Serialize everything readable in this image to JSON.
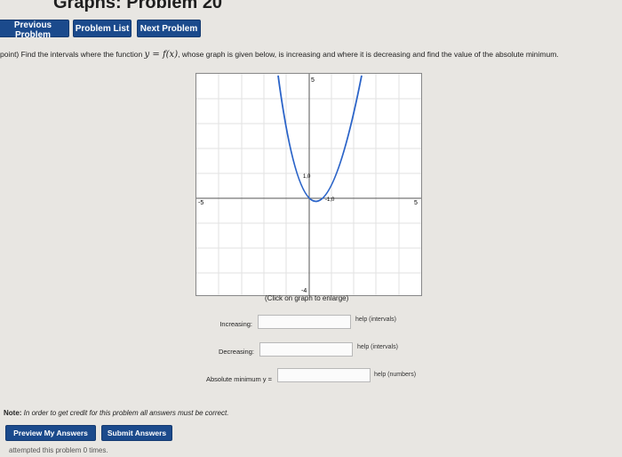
{
  "header": {
    "title": "Graphs: Problem 20"
  },
  "nav": {
    "previous_label": "Previous Problem",
    "list_label": "Problem List",
    "next_label": "Next Problem"
  },
  "problem": {
    "prefix": "point) Find the intervals where the function",
    "func_y": "y",
    "func_eq": " = ",
    "func_f": "f(x)",
    "suffix": ", whose graph is given below, is increasing and where it is decreasing and find the value of the absolute minimum."
  },
  "graph": {
    "x_min_label": "-5",
    "x_max_label": "5",
    "y_max_label": "5",
    "y_min_label": "-4",
    "point1_label": "1,0",
    "point2_label": "-1,0",
    "caption": "(Click on graph to enlarge)"
  },
  "answers": {
    "increasing_label": "Increasing:",
    "increasing_value": "",
    "increasing_help": "help (intervals)",
    "decreasing_label": "Decreasing:",
    "decreasing_value": "",
    "decreasing_help": "help (intervals)",
    "absmin_label": "Absolute minimum y =",
    "absmin_value": "",
    "absmin_help": "help (numbers)"
  },
  "note": {
    "label": "Note:",
    "text": " In order to get credit for this problem all answers must be correct."
  },
  "actions": {
    "preview_label": "Preview My Answers",
    "submit_label": "Submit Answers"
  },
  "attempts_text": "attempted this problem 0 times."
}
